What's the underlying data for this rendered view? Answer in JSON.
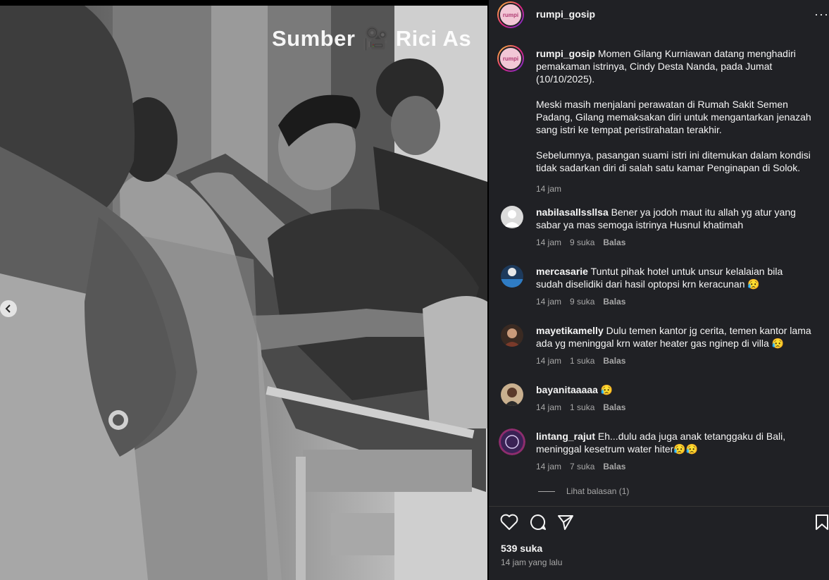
{
  "media": {
    "watermark": "Sumber 🎥 Rici As",
    "prev_button_label": "Previous"
  },
  "post": {
    "username": "rumpi_gosip",
    "avatar_text": "rumpi",
    "caption_user": "rumpi_gosip",
    "caption_p1": " Momen Gilang Kurniawan datang menghadiri pemakaman istrinya, Cindy Desta Nanda, pada Jumat (10/10/2025).",
    "caption_p2": "Meski masih menjalani perawatan di Rumah Sakit Semen Padang, Gilang memaksakan diri untuk mengantarkan jenazah sang istri ke tempat peristirahatan terakhir.",
    "caption_p3": "Sebelumnya, pasangan suami istri ini ditemukan dalam kondisi tidak sadarkan diri di salah satu kamar Penginapan di Solok.",
    "caption_time": "14 jam",
    "more_label": "···"
  },
  "comments": [
    {
      "user": "nabilasallssllsa",
      "text": " Bener ya jodoh maut itu allah yg atur yang sabar ya mas semoga istrinya Husnul khatimah",
      "time": "14 jam",
      "likes": "9 suka",
      "reply": "Balas"
    },
    {
      "user": "mercasarie",
      "text": " Tuntut pihak hotel untuk unsur kelalaian bila sudah diselidiki dari hasil optopsi krn keracunan 😥",
      "time": "14 jam",
      "likes": "9 suka",
      "reply": "Balas"
    },
    {
      "user": "mayetikamelly",
      "text": " Dulu temen kantor jg cerita, temen kantor lama ada yg meninggal krn water heater gas nginep di villa 😥",
      "time": "14 jam",
      "likes": "1 suka",
      "reply": "Balas"
    },
    {
      "user": "bayanitaaaaa",
      "text": " 😥",
      "time": "14 jam",
      "likes": "1 suka",
      "reply": "Balas"
    },
    {
      "user": "lintang_rajut",
      "text": " Eh...dulu ada juga anak tetanggaku di Bali, meninggal kesetrum water hiter😥😥",
      "time": "14 jam",
      "likes": "7 suka",
      "reply": "Balas"
    }
  ],
  "view_replies": "Lihat balasan (1)",
  "footer": {
    "likes": "539 suka",
    "time_ago": "14 jam yang lalu"
  },
  "icons": [
    "chevron-left-icon",
    "heart-icon",
    "comment-icon",
    "share-icon",
    "bookmark-icon",
    "more-icon"
  ]
}
